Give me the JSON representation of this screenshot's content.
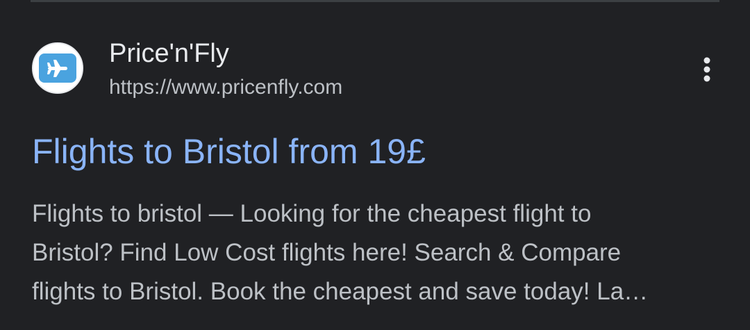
{
  "result": {
    "site_name": "Price'n'Fly",
    "site_url": "https://www.pricenfly.com",
    "favicon_icon": "airplane-icon",
    "favicon_color": "#4aa3df",
    "more_icon": "more-vert-icon",
    "title": "Flights to Bristol from 19£",
    "snippet_lines": [
      "Flights to bristol — Looking for the cheapest flight to",
      "Bristol? Find Low Cost flights here! Search & Compare",
      "flights to Bristol. Book the cheapest and save today! La…"
    ]
  },
  "colors": {
    "background": "#202124",
    "title_link": "#8ab4f8",
    "primary_text": "#e8eaed",
    "secondary_text": "#bdc1c6"
  }
}
